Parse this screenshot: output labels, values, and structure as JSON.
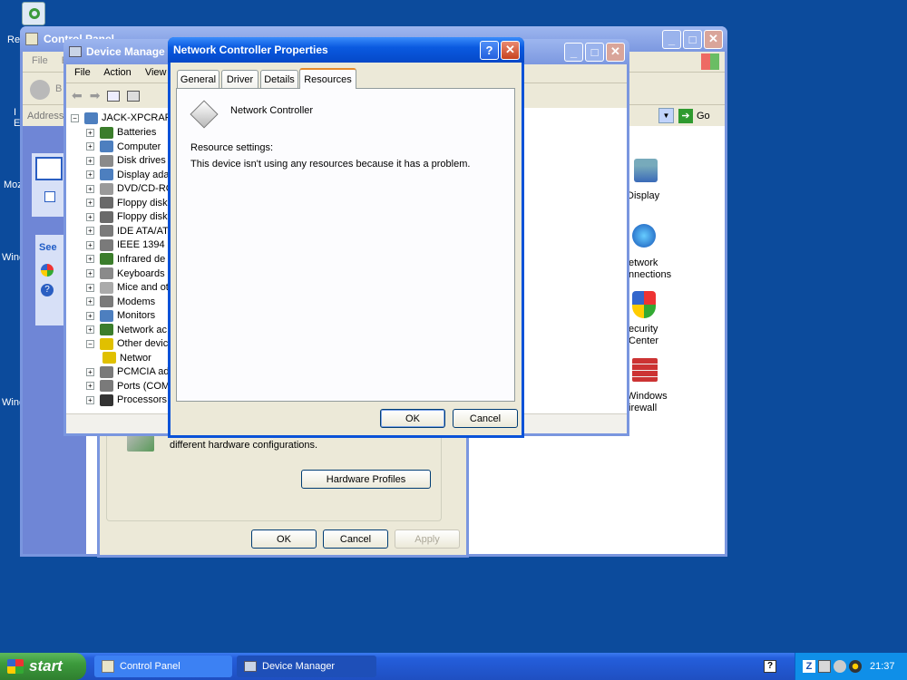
{
  "desktop": {
    "icons": [
      {
        "label": "Re",
        "icon": "recycle-bin-icon"
      },
      {
        "label": "Moz",
        "icon": "mozilla-icon"
      },
      {
        "label": "Winc",
        "icon": "windows-icon"
      },
      {
        "label": "Winc",
        "icon": "windows-icon"
      }
    ]
  },
  "control_panel": {
    "title": "Control Panel",
    "menu": [
      "File",
      "E"
    ],
    "back_label": "B",
    "address_label": "Address",
    "go_label": "Go",
    "side_see_label": "See",
    "items": [
      {
        "label": "Display",
        "icon": "display-icon"
      },
      {
        "label": "Network Connections",
        "line1": "etwork",
        "line2": "nnections",
        "icon": "network-connections-icon"
      },
      {
        "label": "Security Center",
        "line1": "ecurity",
        "line2": "Center",
        "icon": "security-center-icon"
      },
      {
        "label": "Windows Firewall",
        "line1": "Windows",
        "line2": "irewall",
        "icon": "firewall-icon"
      }
    ]
  },
  "system_properties": {
    "text": "different hardware configurations.",
    "hardware_profiles_label": "Hardware Profiles",
    "ok_label": "OK",
    "cancel_label": "Cancel",
    "apply_label": "Apply"
  },
  "device_manager": {
    "title": "Device Manage",
    "menu": [
      "File",
      "Action",
      "View"
    ],
    "root": "JACK-XPCRAPT",
    "nodes": [
      {
        "label": "Batteries",
        "icon": "battery-icon",
        "color": "#3b7d2b"
      },
      {
        "label": "Computer",
        "icon": "computer-icon",
        "color": "#4d7fbf"
      },
      {
        "label": "Disk drives",
        "icon": "disk-drive-icon",
        "color": "#8a8a8a"
      },
      {
        "label": "Display ada",
        "icon": "display-adapter-icon",
        "color": "#4d7fbf"
      },
      {
        "label": "DVD/CD-RO",
        "icon": "cd-drive-icon",
        "color": "#9a9a9a"
      },
      {
        "label": "Floppy disk",
        "icon": "floppy-icon",
        "color": "#6a6a6a"
      },
      {
        "label": "Floppy disk",
        "icon": "floppy-icon",
        "color": "#6a6a6a"
      },
      {
        "label": "IDE ATA/AT",
        "icon": "ide-controller-icon",
        "color": "#7a7a7a"
      },
      {
        "label": "IEEE 1394 I",
        "icon": "ieee1394-icon",
        "color": "#7a7a7a"
      },
      {
        "label": "Infrared de",
        "icon": "infrared-icon",
        "color": "#3b7d2b"
      },
      {
        "label": "Keyboards",
        "icon": "keyboard-icon",
        "color": "#8a8a8a"
      },
      {
        "label": "Mice and ot",
        "icon": "mouse-icon",
        "color": "#aaaaaa"
      },
      {
        "label": "Modems",
        "icon": "modem-icon",
        "color": "#7a7a7a"
      },
      {
        "label": "Monitors",
        "icon": "monitor-icon",
        "color": "#4d7fbf"
      },
      {
        "label": "Network ac",
        "icon": "network-adapter-icon",
        "color": "#3b7d2b"
      },
      {
        "label": "Other devic",
        "icon": "unknown-device-icon",
        "color": "#e0c000",
        "expanded": true
      },
      {
        "label": "Networ",
        "icon": "warning-device-icon",
        "color": "#e0c000",
        "child": true
      },
      {
        "label": "PCMCIA ad",
        "icon": "pcmcia-icon",
        "color": "#7a7a7a"
      },
      {
        "label": "Ports (COM",
        "icon": "port-icon",
        "color": "#7a7a7a"
      },
      {
        "label": "Processors",
        "icon": "processor-icon",
        "color": "#333333"
      }
    ]
  },
  "dialog": {
    "title": "Network Controller Properties",
    "tabs": [
      "General",
      "Driver",
      "Details",
      "Resources"
    ],
    "active_tab": "Resources",
    "device_name": "Network Controller",
    "resource_settings_label": "Resource settings:",
    "message": "This device isn't using any resources because it has a problem.",
    "ok_label": "OK",
    "cancel_label": "Cancel"
  },
  "taskbar": {
    "start_label": "start",
    "tasks": [
      {
        "label": "Control Panel",
        "icon": "control-panel-icon"
      },
      {
        "label": "Device Manager",
        "icon": "device-manager-icon"
      }
    ],
    "clock": "21:37"
  },
  "colors": {
    "desktop": "#0c4b9c",
    "titlebar": "#0a52d8",
    "taskbar": "#245edb",
    "start": "#3c9a3c",
    "tab_highlight": "#e68b2c"
  }
}
